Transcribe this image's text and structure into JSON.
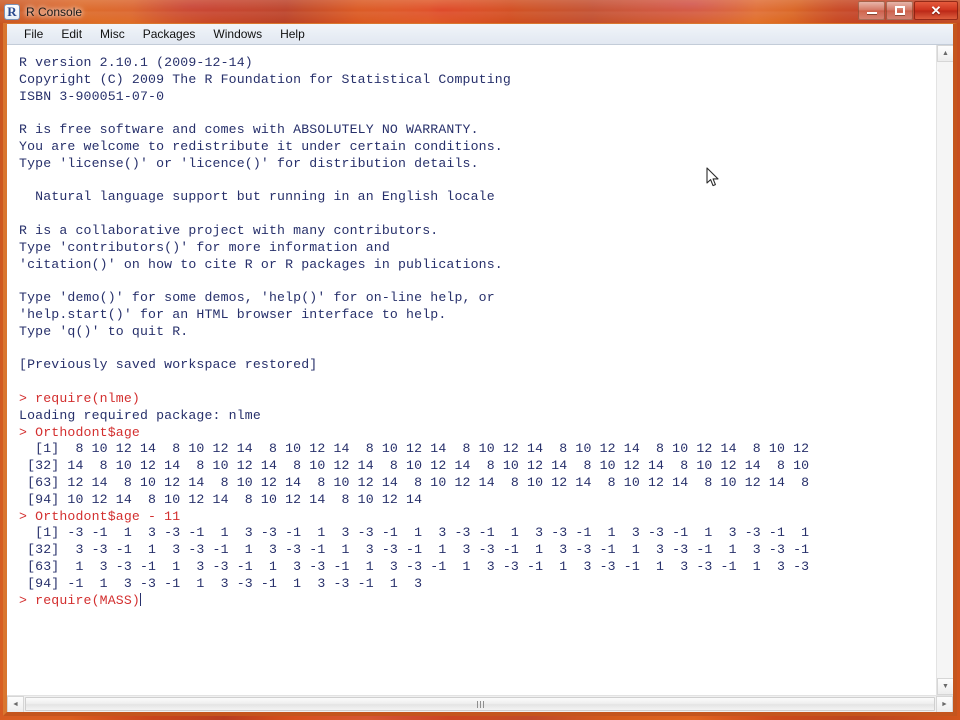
{
  "window": {
    "title": "R Console",
    "icon": "r-logo-icon",
    "controls": {
      "minimize": "minimize-button",
      "maximize": "maximize-button",
      "close": "close-button",
      "close_glyph": "✕"
    }
  },
  "menubar": {
    "items": [
      {
        "label": "File"
      },
      {
        "label": "Edit"
      },
      {
        "label": "Misc"
      },
      {
        "label": "Packages"
      },
      {
        "label": "Windows"
      },
      {
        "label": "Help"
      }
    ]
  },
  "colors": {
    "output_text": "#27306b",
    "command_text": "#d32f2f",
    "console_background": "#ffffff",
    "frame_orange": "#d9762f",
    "titlebar_tint": "#cf5520"
  },
  "console": {
    "banner": [
      "R version 2.10.1 (2009-12-14)",
      "Copyright (C) 2009 The R Foundation for Statistical Computing",
      "ISBN 3-900051-07-0",
      "",
      "R is free software and comes with ABSOLUTELY NO WARRANTY.",
      "You are welcome to redistribute it under certain conditions.",
      "Type 'license()' or 'licence()' for distribution details.",
      "",
      "  Natural language support but running in an English locale",
      "",
      "R is a collaborative project with many contributors.",
      "Type 'contributors()' for more information and",
      "'citation()' on how to cite R or R packages in publications.",
      "",
      "Type 'demo()' for some demos, 'help()' for on-line help, or",
      "'help.start()' for an HTML browser interface to help.",
      "Type 'q()' to quit R.",
      "",
      "[Previously saved workspace restored]",
      ""
    ],
    "session": [
      {
        "kind": "command",
        "prompt": "> ",
        "text": "require(nlme)"
      },
      {
        "kind": "output",
        "text": "Loading required package: nlme"
      },
      {
        "kind": "command",
        "prompt": "> ",
        "text": "Orthodont$age"
      },
      {
        "kind": "output",
        "text": "  [1]  8 10 12 14  8 10 12 14  8 10 12 14  8 10 12 14  8 10 12 14  8 10 12 14  8 10 12 14  8 10 12"
      },
      {
        "kind": "output",
        "text": " [32] 14  8 10 12 14  8 10 12 14  8 10 12 14  8 10 12 14  8 10 12 14  8 10 12 14  8 10 12 14  8 10"
      },
      {
        "kind": "output",
        "text": " [63] 12 14  8 10 12 14  8 10 12 14  8 10 12 14  8 10 12 14  8 10 12 14  8 10 12 14  8 10 12 14  8"
      },
      {
        "kind": "output",
        "text": " [94] 10 12 14  8 10 12 14  8 10 12 14  8 10 12 14"
      },
      {
        "kind": "command",
        "prompt": "> ",
        "text": "Orthodont$age - 11"
      },
      {
        "kind": "output",
        "text": "  [1] -3 -1  1  3 -3 -1  1  3 -3 -1  1  3 -3 -1  1  3 -3 -1  1  3 -3 -1  1  3 -3 -1  1  3 -3 -1  1"
      },
      {
        "kind": "output",
        "text": " [32]  3 -3 -1  1  3 -3 -1  1  3 -3 -1  1  3 -3 -1  1  3 -3 -1  1  3 -3 -1  1  3 -3 -1  1  3 -3 -1"
      },
      {
        "kind": "output",
        "text": " [63]  1  3 -3 -1  1  3 -3 -1  1  3 -3 -1  1  3 -3 -1  1  3 -3 -1  1  3 -3 -1  1  3 -3 -1  1  3 -3"
      },
      {
        "kind": "output",
        "text": " [94] -1  1  3 -3 -1  1  3 -3 -1  1  3 -3 -1  1  3"
      },
      {
        "kind": "command",
        "prompt": "> ",
        "text": "require(MASS)",
        "caret": true
      }
    ]
  },
  "scrollbars": {
    "vertical": {
      "up_arrow": "▲",
      "down_arrow": "▼",
      "name": "vertical-scrollbar"
    },
    "horizontal": {
      "left_arrow": "◄",
      "right_arrow": "►",
      "name": "horizontal-scrollbar"
    }
  }
}
